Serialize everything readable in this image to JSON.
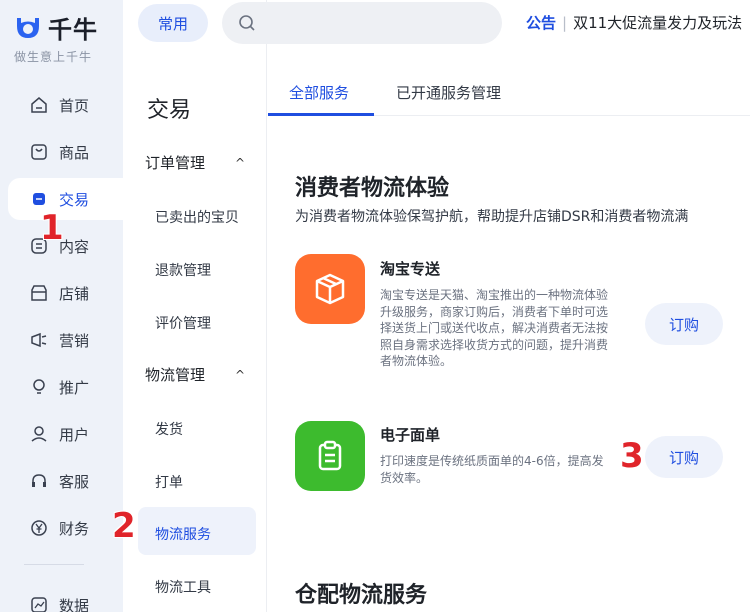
{
  "brand": {
    "name": "千牛",
    "slogan": "做生意上千牛"
  },
  "rail": {
    "items": [
      {
        "label": "首页",
        "icon": "home-icon"
      },
      {
        "label": "商品",
        "icon": "goods-icon"
      },
      {
        "label": "交易",
        "icon": "trade-icon"
      },
      {
        "label": "内容",
        "icon": "content-icon"
      },
      {
        "label": "店铺",
        "icon": "store-icon"
      },
      {
        "label": "营销",
        "icon": "megaphone-icon"
      },
      {
        "label": "推广",
        "icon": "bulb-icon"
      },
      {
        "label": "用户",
        "icon": "user-icon"
      },
      {
        "label": "客服",
        "icon": "headset-icon"
      },
      {
        "label": "财务",
        "icon": "yen-icon"
      },
      {
        "label": "数据",
        "icon": "chart-icon"
      }
    ]
  },
  "topbar": {
    "common_label": "常用",
    "search_placeholder": "",
    "notice_tag": "公告",
    "notice_text": "双11大促流量发力及玩法"
  },
  "subnav": {
    "title": "交易",
    "groups": [
      {
        "label": "订单管理",
        "items": [
          "已卖出的宝贝",
          "退款管理",
          "评价管理"
        ]
      },
      {
        "label": "物流管理",
        "items": [
          "发货",
          "打单",
          "物流服务",
          "物流工具"
        ]
      }
    ]
  },
  "tabs": [
    "全部服务",
    "已开通服务管理"
  ],
  "content": {
    "section1_title": "消费者物流体验",
    "section1_desc": "为消费者物流体验保驾护航，帮助提升店铺DSR和消费者物流满",
    "services": [
      {
        "name": "淘宝专送",
        "desc": "淘宝专送是天猫、淘宝推出的一种物流体验升级服务，商家订购后，消费者下单时可选择送货上门或送代收点，解决消费者无法按照自身需求选择收货方式的问题，提升消费者物流体验。",
        "button": "订购",
        "color": "#ff6d2e"
      },
      {
        "name": "电子面单",
        "desc": "打印速度是传统纸质面单的4-6倍，提高发货效率。",
        "button": "订购",
        "color": "#3dbb2e"
      }
    ],
    "section2_title": "仓配物流服务"
  },
  "annotations": [
    "1",
    "2",
    "3"
  ],
  "colors": {
    "accent": "#1f4ee0",
    "annotation": "#e0242a"
  }
}
